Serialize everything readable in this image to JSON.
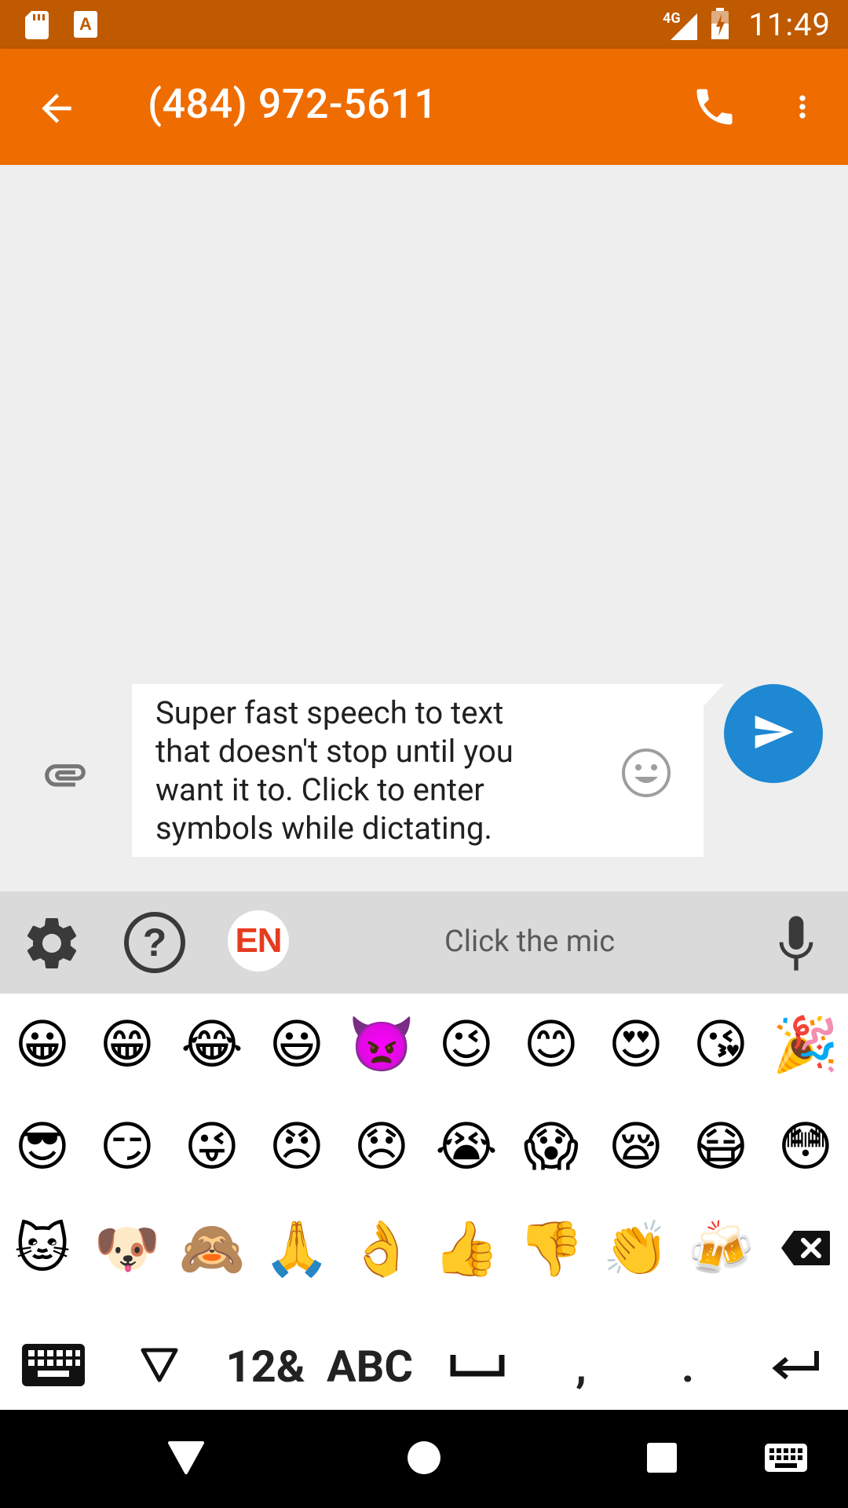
{
  "status_bar": {
    "time": "11:49",
    "network": "4G",
    "left_icons": [
      "sd-card-icon",
      "app-a-icon"
    ],
    "right_icons": [
      "signal-icon",
      "battery-charging-icon"
    ]
  },
  "app_bar": {
    "title": "(484) 972-5611",
    "back_icon": "arrow-back-icon",
    "call_icon": "phone-icon",
    "more_icon": "more-vert-icon"
  },
  "composer": {
    "message": "Super fast speech to text that doesn't stop until you want it to. Click to enter symbols while dictating.",
    "attach_icon": "paperclip-icon",
    "emoji_icon": "smiley-icon",
    "send_icon": "send-icon"
  },
  "keyboard_toolbar": {
    "language_badge": "EN",
    "hint": "Click the mic",
    "settings_icon": "gear-icon",
    "help_icon": "help-icon",
    "mic_icon": "mic-icon"
  },
  "emoji_rows": [
    [
      "😀",
      "😁",
      "😂",
      "😃",
      "👿",
      "😉",
      "😊",
      "😍",
      "😘",
      "🎉"
    ],
    [
      "😎",
      "😏",
      "😜",
      "😠",
      "😞",
      "😭",
      "😱",
      "😪",
      "😷",
      "😳"
    ],
    [
      "🐱",
      "🐶",
      "🙈",
      "🙏",
      "👌",
      "👍",
      "👎",
      "👏",
      "🍻",
      "⌫"
    ]
  ],
  "keyboard_bottom": {
    "keyboard_icon": "keyboard-icon",
    "hide_icon": "triangle-down-icon",
    "numbers_label": "12&",
    "abc_label": "ABC",
    "space_icon": "space-icon",
    "comma_label": ",",
    "period_label": ".",
    "enter_icon": "enter-icon"
  },
  "nav_bar": {
    "back_icon": "nav-back-icon",
    "home_icon": "nav-home-icon",
    "recents_icon": "nav-recents-icon",
    "keyboard_icon": "nav-keyboard-icon"
  },
  "colors": {
    "status_bar": "#bf5a00",
    "app_bar": "#ef6c00",
    "send_button": "#1e88d2",
    "language_badge": "#e53b1f"
  }
}
